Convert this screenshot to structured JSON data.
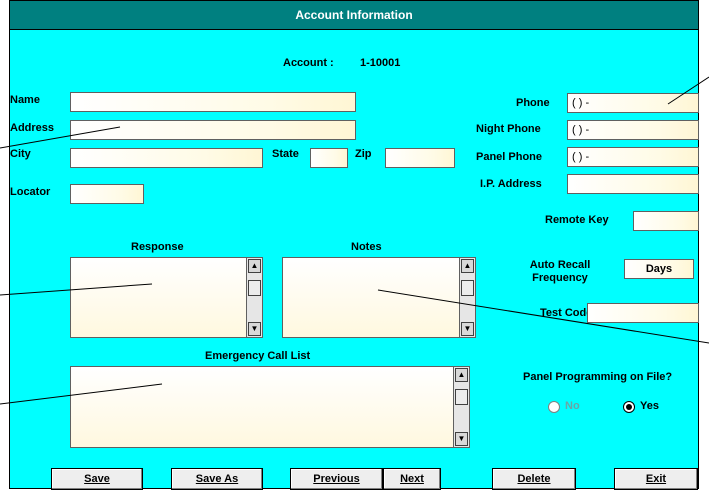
{
  "window": {
    "title": "Account Information"
  },
  "account": {
    "label": "Account :",
    "value": "1-10001"
  },
  "fields": {
    "name": {
      "label": "Name",
      "value": ""
    },
    "address": {
      "label": "Address",
      "value": ""
    },
    "city": {
      "label": "City",
      "value": ""
    },
    "state": {
      "label": "State",
      "value": ""
    },
    "zip": {
      "label": "Zip",
      "value": ""
    },
    "locator": {
      "label": "Locator",
      "value": ""
    },
    "phone": {
      "label": "Phone",
      "value": "(   )     -"
    },
    "night_phone": {
      "label": "Night Phone",
      "value": "(   )     -"
    },
    "panel_phone": {
      "label": "Panel Phone",
      "value": "(   )     -"
    },
    "ip_address": {
      "label": "I.P. Address",
      "value": ""
    },
    "remote_key": {
      "label": "Remote Key",
      "value": ""
    },
    "auto_recall": {
      "label": "Auto Recall Frequency",
      "value": "Days"
    },
    "test_code": {
      "label": "Test Code",
      "value": ""
    }
  },
  "sections": {
    "response": "Response",
    "notes": "Notes",
    "emergency": "Emergency Call List"
  },
  "panel_programming": {
    "question": "Panel Programming on File?",
    "options": [
      "No",
      "Yes"
    ],
    "selected": "Yes"
  },
  "buttons": {
    "save": "Save",
    "save_as": "Save As",
    "previous": "Previous",
    "next": "Next",
    "delete": "Delete",
    "exit": "Exit"
  },
  "colors": {
    "background": "#00ffff",
    "titlebar": "#008080"
  }
}
